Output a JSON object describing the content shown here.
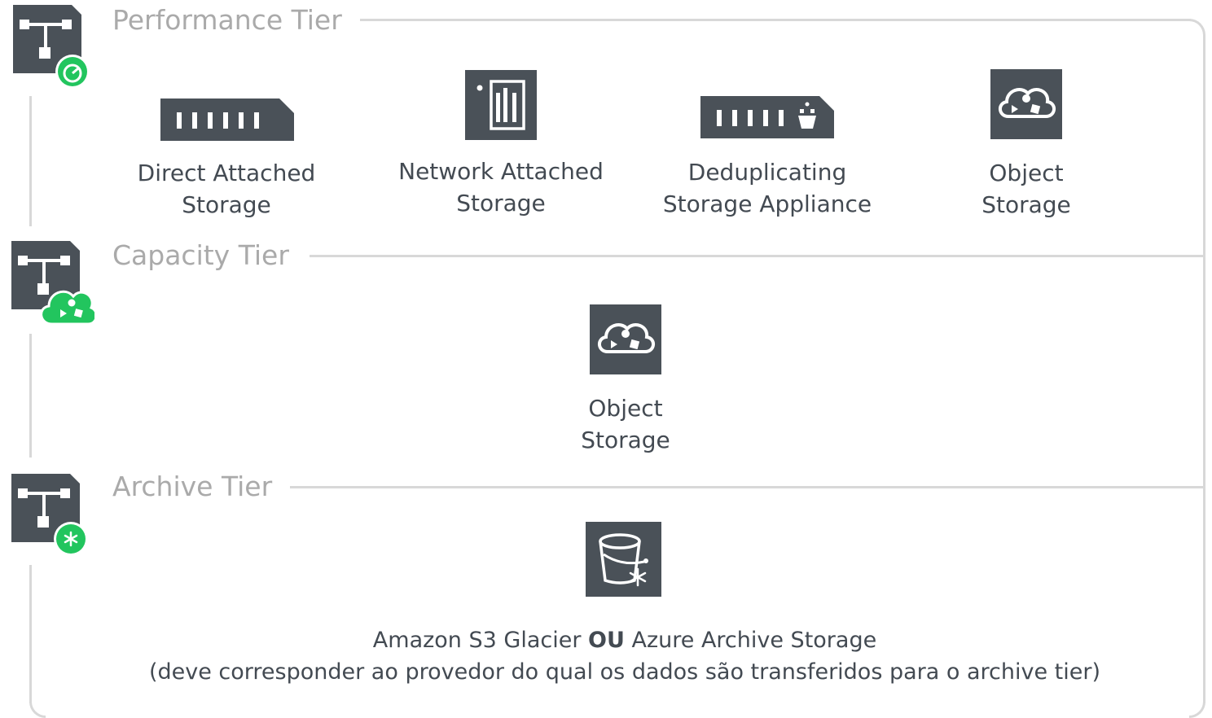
{
  "tiers": {
    "performance": {
      "title": "Performance Tier",
      "items": {
        "das": {
          "line1": "Direct Attached",
          "line2": "Storage"
        },
        "nas": {
          "line1": "Network Attached",
          "line2": "Storage"
        },
        "dedup": {
          "line1": "Deduplicating",
          "line2": "Storage Appliance"
        },
        "object": {
          "line1": "Object",
          "line2": "Storage"
        }
      }
    },
    "capacity": {
      "title": "Capacity Tier",
      "items": {
        "object": {
          "line1": "Object",
          "line2": "Storage"
        }
      }
    },
    "archive": {
      "title": "Archive Tier",
      "line1_part1": "Amazon S3 Glacier ",
      "line1_bold": "OU",
      "line1_part2": " Azure Archive Storage",
      "line2": "(deve corresponder ao provedor do qual os dados são transferidos para o archive tier)"
    }
  },
  "colors": {
    "icon_dark": "#4a5158",
    "accent_green": "#22c55e",
    "line_gray": "#d8d8d8",
    "title_gray": "#aaaaaa",
    "text_dark": "#434a52"
  },
  "icons": {
    "performance_tier": "scale-out-repo-speedometer-icon",
    "capacity_tier": "scale-out-repo-cloud-icon",
    "archive_tier": "scale-out-repo-snowflake-icon",
    "das": "disk-array-icon",
    "nas": "nas-device-icon",
    "dedup": "dedup-appliance-icon",
    "object": "object-storage-cloud-icon",
    "glacier": "cold-bucket-icon"
  }
}
